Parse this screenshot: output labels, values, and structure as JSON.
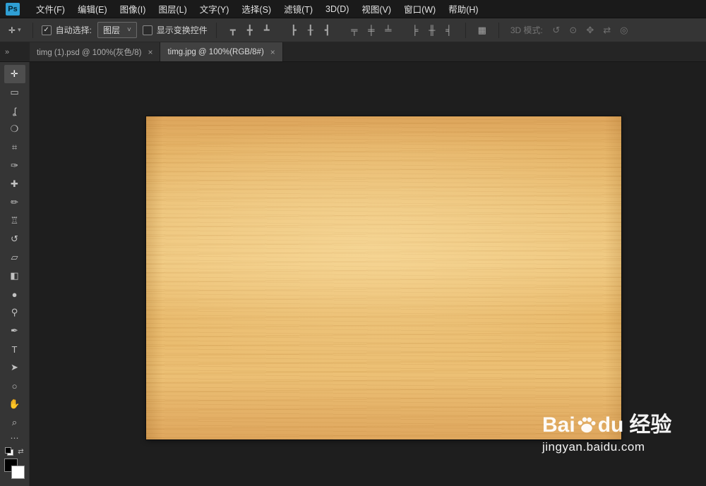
{
  "menu_bar": {
    "logo": "Ps",
    "items": [
      {
        "label": "文件(F)"
      },
      {
        "label": "编辑(E)"
      },
      {
        "label": "图像(I)"
      },
      {
        "label": "图层(L)"
      },
      {
        "label": "文字(Y)"
      },
      {
        "label": "选择(S)"
      },
      {
        "label": "滤镜(T)"
      },
      {
        "label": "3D(D)"
      },
      {
        "label": "视图(V)"
      },
      {
        "label": "窗口(W)"
      },
      {
        "label": "帮助(H)"
      }
    ]
  },
  "options_bar": {
    "tool_preset_glyph": "✛",
    "tool_preset_caret": "▾",
    "auto_select": {
      "label": "自动选择:",
      "checked": true,
      "glyph": "✓"
    },
    "layer_select": {
      "value": "图层",
      "caret": "˅"
    },
    "show_transform": {
      "label": "显示变换控件",
      "checked": false
    },
    "align_groups": [
      [
        {
          "name": "align-top-edges-icon",
          "glyph": "┳"
        },
        {
          "name": "align-vertical-centers-icon",
          "glyph": "╋"
        },
        {
          "name": "align-bottom-edges-icon",
          "glyph": "┻"
        }
      ],
      [
        {
          "name": "align-left-edges-icon",
          "glyph": "┣"
        },
        {
          "name": "align-horizontal-centers-icon",
          "glyph": "╂"
        },
        {
          "name": "align-right-edges-icon",
          "glyph": "┫"
        }
      ],
      [
        {
          "name": "distribute-top-edges-icon",
          "glyph": "╤"
        },
        {
          "name": "distribute-vertical-centers-icon",
          "glyph": "╪"
        },
        {
          "name": "distribute-bottom-edges-icon",
          "glyph": "╧"
        }
      ],
      [
        {
          "name": "distribute-left-edges-icon",
          "glyph": "╞"
        },
        {
          "name": "distribute-horizontal-centers-icon",
          "glyph": "╫"
        },
        {
          "name": "distribute-right-edges-icon",
          "glyph": "╡"
        }
      ]
    ],
    "auto_align": {
      "glyph": "▦"
    },
    "threed_label": "3D 模式:",
    "threed_icons": [
      {
        "name": "3d-rotate-icon",
        "glyph": "↺"
      },
      {
        "name": "3d-roll-icon",
        "glyph": "⊙"
      },
      {
        "name": "3d-drag-icon",
        "glyph": "✥"
      },
      {
        "name": "3d-slide-icon",
        "glyph": "⇄"
      },
      {
        "name": "3d-scale-icon",
        "glyph": "◎"
      }
    ]
  },
  "tab_bar": {
    "collapse_glyph": "»",
    "tabs": [
      {
        "title": "timg (1).psd @ 100%(灰色/8)",
        "close": "×",
        "active": false
      },
      {
        "title": "timg.jpg @ 100%(RGB/8#)",
        "close": "×",
        "active": true
      }
    ]
  },
  "toolbar": {
    "more_glyph": "⋯",
    "tools": [
      {
        "name": "move-tool",
        "glyph": "✛",
        "active": true
      },
      {
        "name": "rectangular-marquee-tool",
        "glyph": "▭",
        "active": false
      },
      {
        "name": "lasso-tool",
        "glyph": "ʆ",
        "active": false
      },
      {
        "name": "quick-selection-tool",
        "glyph": "❍",
        "active": false
      },
      {
        "name": "crop-tool",
        "glyph": "⌗",
        "active": false
      },
      {
        "name": "eyedropper-tool",
        "glyph": "✑",
        "active": false
      },
      {
        "name": "spot-healing-brush-tool",
        "glyph": "✚",
        "active": false
      },
      {
        "name": "brush-tool",
        "glyph": "✏",
        "active": false
      },
      {
        "name": "clone-stamp-tool",
        "glyph": "♖",
        "active": false
      },
      {
        "name": "history-brush-tool",
        "glyph": "↺",
        "active": false
      },
      {
        "name": "eraser-tool",
        "glyph": "▱",
        "active": false
      },
      {
        "name": "gradient-tool",
        "glyph": "◧",
        "active": false
      },
      {
        "name": "blur-tool",
        "glyph": "●",
        "active": false
      },
      {
        "name": "dodge-tool",
        "glyph": "⚲",
        "active": false
      },
      {
        "name": "pen-tool",
        "glyph": "✒",
        "active": false
      },
      {
        "name": "type-tool",
        "glyph": "T",
        "active": false
      },
      {
        "name": "path-selection-tool",
        "glyph": "➤",
        "active": false
      },
      {
        "name": "ellipse-tool",
        "glyph": "○",
        "active": false
      },
      {
        "name": "hand-tool",
        "glyph": "✋",
        "active": false
      },
      {
        "name": "zoom-tool",
        "glyph": "⌕",
        "active": false
      }
    ],
    "swap_glyph": "⇄"
  },
  "watermark": {
    "brand_pre": "Bai",
    "brand_post": "du",
    "brand_cn": "经验",
    "url": "jingyan.baidu.com"
  },
  "colors": {
    "accent_logo": "#2f9fd4",
    "canvas_bg": "#1e1e1e",
    "panel_bg": "#353535",
    "wood_light": "#efc77e",
    "wood_mid": "#e9ba6c",
    "wood_dark": "#dda55c"
  }
}
